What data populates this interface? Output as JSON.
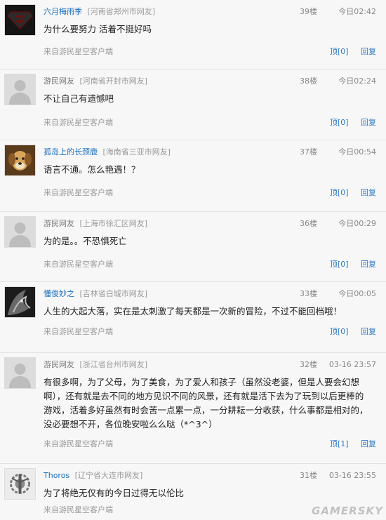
{
  "source_label": "来自游民星空客户端",
  "reply_label": "回复",
  "comments": [
    {
      "user": "六月梅雨季",
      "location": "[河南省郑州市网友]",
      "floor": "39楼",
      "time": "今日02:42",
      "text": "为什么要努力 活着不挺好吗",
      "vote": "顶[0]",
      "avatar": "superman-logo-icon"
    },
    {
      "user": "游民网友",
      "location": "[河南省开封市网友]",
      "floor": "38楼",
      "time": "今日02:24",
      "text": "不让自己有遗憾吧",
      "vote": "顶[0]",
      "avatar": "default-user-icon"
    },
    {
      "user": "孤岛上的长颈鹿",
      "location": "[海南省三亚市网友]",
      "floor": "37楼",
      "time": "今日00:54",
      "text": "语言不通。怎么艳遇！？",
      "vote": "顶[0]",
      "avatar": "puppy-photo-icon"
    },
    {
      "user": "游民网友",
      "location": "[上海市徐汇区网友]",
      "floor": "36楼",
      "time": "今日00:29",
      "text": "为的是。。不恐惧死亡",
      "vote": "顶[0]",
      "avatar": "default-user-icon"
    },
    {
      "user": "懂俊妙之",
      "location": "[吉林省白城市网友]",
      "floor": "33楼",
      "time": "今日00:05",
      "text": "人生的大起大落，实在是太刺激了每天都是一次新的冒险，不过不能回档哦！",
      "vote": "顶[0]",
      "avatar": "dark-character-icon"
    },
    {
      "user": "游民网友",
      "location": "[浙江省台州市网友]",
      "floor": "32楼",
      "time": "03-16 23:57",
      "text": "有很多啊，为了父母，为了美食，为了爱人和孩子（虽然没老婆，但是人要会幻想啊），还有就是去不同的地方见识不同的风景，还有就是活下去为了玩到以后更棒的游戏，活着多好虽然有时会苦一点累一点，一分耕耘一分收获，什么事都是相对的，没必要想不开，各位晚安啦么么哒（*^3^）",
      "vote": "顶[1]",
      "avatar": "default-user-icon"
    },
    {
      "user": "Thoros",
      "location": "[辽宁省大连市网友]",
      "floor": "31楼",
      "time": "03-16 23:55",
      "text": "为了将绝无仅有的今日过得无以伦比",
      "vote": "",
      "avatar": "brotherhood-emblem-icon"
    }
  ],
  "watermark": "GAMERSKY",
  "colors": {
    "username_link": "#1a6fc1",
    "action_link": "#2a78c8",
    "background": "#f7f7f7"
  }
}
